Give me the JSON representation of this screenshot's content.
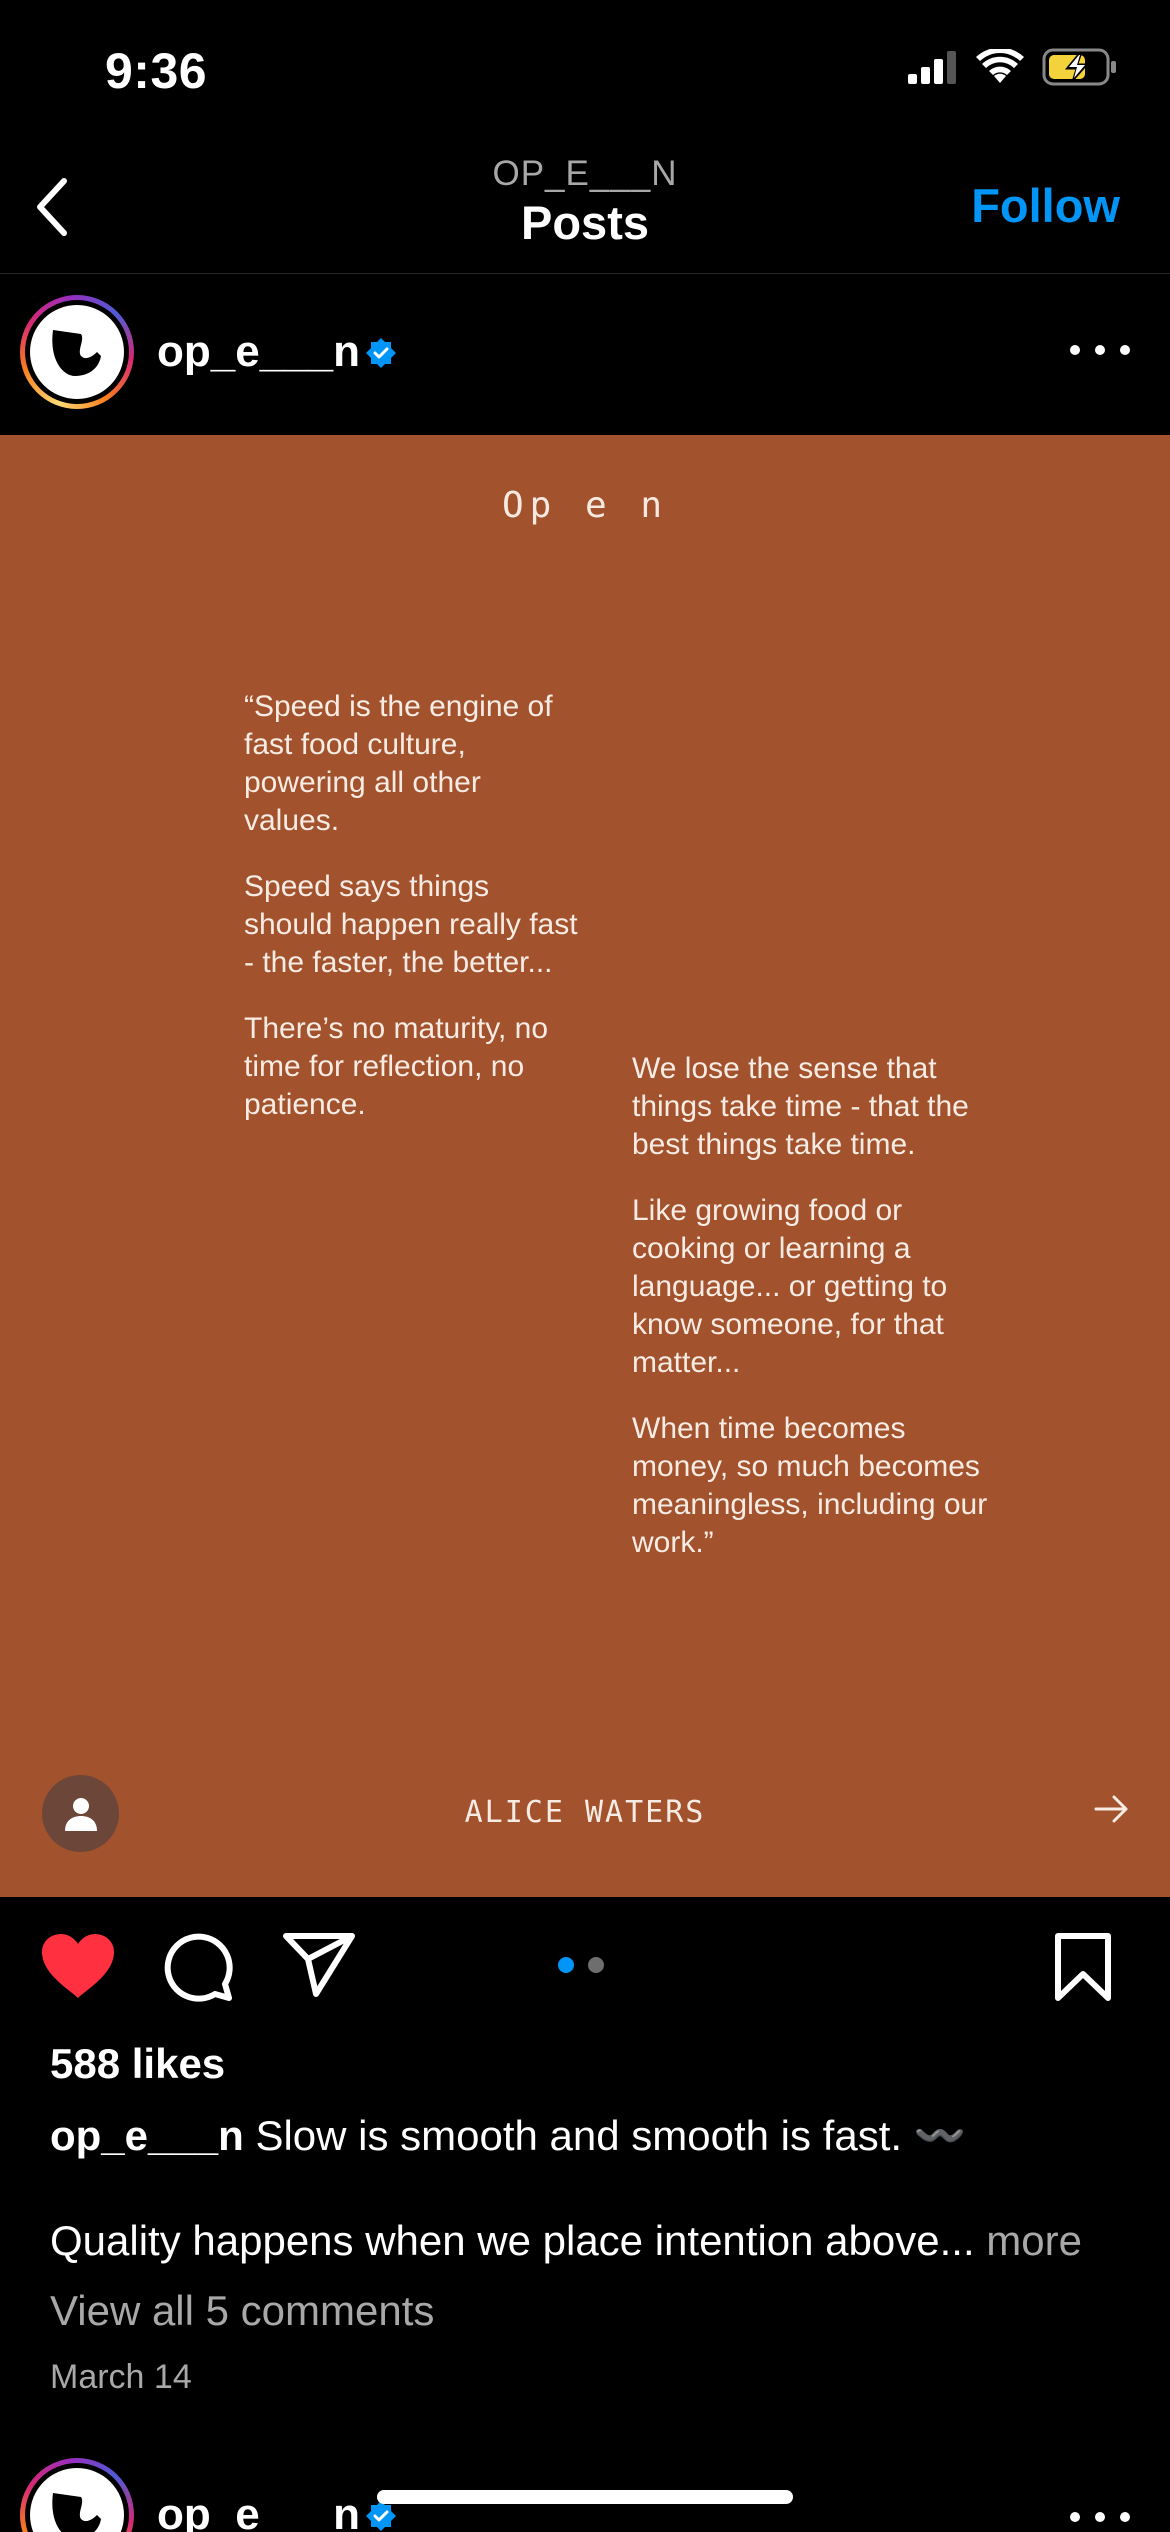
{
  "status_bar": {
    "time": "9:36",
    "icons": [
      "cellular-signal-icon",
      "wifi-icon",
      "battery-charging-icon"
    ]
  },
  "header": {
    "subtitle": "OP_E___N",
    "title": "Posts",
    "follow_label": "Follow"
  },
  "post": {
    "username": "op_e___n",
    "verified": true,
    "media": {
      "brand": "Op e  n",
      "quote_left": [
        "“Speed is the engine of fast food culture, powering all other values.",
        "Speed says things should happen really fast - the faster, the better...",
        "There’s no maturity, no time for reflection, no patience."
      ],
      "quote_right": [
        "We lose the sense that things take time - that the best things take time.",
        "Like growing food or cooking or learning a language... or getting to know someone, for that matter...",
        "When time becomes money, so much becomes meaningless, including our work.”"
      ],
      "author": "ALICE WATERS",
      "background_color": "#a3522e"
    },
    "carousel": {
      "count": 2,
      "active": 0
    },
    "likes": "588 likes",
    "caption_user": "op_e___n",
    "caption_text": "Slow is smooth and smooth is fast.",
    "caption_emoji": "〰️",
    "caption_line2": "Quality happens when we place intention above...",
    "more_label": "more",
    "comments_label": "View all 5 comments",
    "date": "March 14",
    "liked": true
  },
  "next_post": {
    "username": "op_e___n"
  },
  "colors": {
    "accent": "#0095f6",
    "like_red": "#ff3040",
    "muted": "#a8a8a8"
  }
}
